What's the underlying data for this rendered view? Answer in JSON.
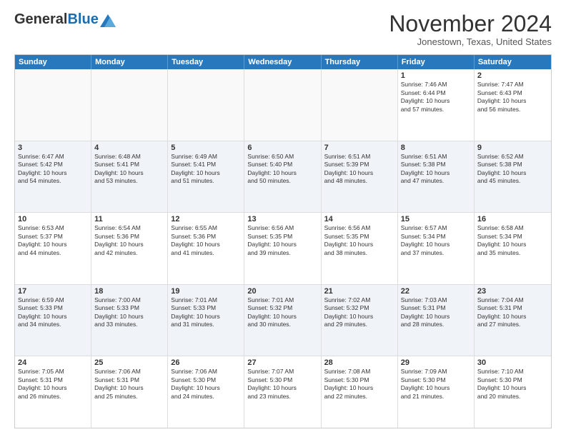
{
  "header": {
    "logo_general": "General",
    "logo_blue": "Blue",
    "month_title": "November 2024",
    "location": "Jonestown, Texas, United States"
  },
  "calendar": {
    "headers": [
      "Sunday",
      "Monday",
      "Tuesday",
      "Wednesday",
      "Thursday",
      "Friday",
      "Saturday"
    ],
    "rows": [
      [
        {
          "day": "",
          "info": ""
        },
        {
          "day": "",
          "info": ""
        },
        {
          "day": "",
          "info": ""
        },
        {
          "day": "",
          "info": ""
        },
        {
          "day": "",
          "info": ""
        },
        {
          "day": "1",
          "info": "Sunrise: 7:46 AM\nSunset: 6:44 PM\nDaylight: 10 hours\nand 57 minutes."
        },
        {
          "day": "2",
          "info": "Sunrise: 7:47 AM\nSunset: 6:43 PM\nDaylight: 10 hours\nand 56 minutes."
        }
      ],
      [
        {
          "day": "3",
          "info": "Sunrise: 6:47 AM\nSunset: 5:42 PM\nDaylight: 10 hours\nand 54 minutes."
        },
        {
          "day": "4",
          "info": "Sunrise: 6:48 AM\nSunset: 5:41 PM\nDaylight: 10 hours\nand 53 minutes."
        },
        {
          "day": "5",
          "info": "Sunrise: 6:49 AM\nSunset: 5:41 PM\nDaylight: 10 hours\nand 51 minutes."
        },
        {
          "day": "6",
          "info": "Sunrise: 6:50 AM\nSunset: 5:40 PM\nDaylight: 10 hours\nand 50 minutes."
        },
        {
          "day": "7",
          "info": "Sunrise: 6:51 AM\nSunset: 5:39 PM\nDaylight: 10 hours\nand 48 minutes."
        },
        {
          "day": "8",
          "info": "Sunrise: 6:51 AM\nSunset: 5:38 PM\nDaylight: 10 hours\nand 47 minutes."
        },
        {
          "day": "9",
          "info": "Sunrise: 6:52 AM\nSunset: 5:38 PM\nDaylight: 10 hours\nand 45 minutes."
        }
      ],
      [
        {
          "day": "10",
          "info": "Sunrise: 6:53 AM\nSunset: 5:37 PM\nDaylight: 10 hours\nand 44 minutes."
        },
        {
          "day": "11",
          "info": "Sunrise: 6:54 AM\nSunset: 5:36 PM\nDaylight: 10 hours\nand 42 minutes."
        },
        {
          "day": "12",
          "info": "Sunrise: 6:55 AM\nSunset: 5:36 PM\nDaylight: 10 hours\nand 41 minutes."
        },
        {
          "day": "13",
          "info": "Sunrise: 6:56 AM\nSunset: 5:35 PM\nDaylight: 10 hours\nand 39 minutes."
        },
        {
          "day": "14",
          "info": "Sunrise: 6:56 AM\nSunset: 5:35 PM\nDaylight: 10 hours\nand 38 minutes."
        },
        {
          "day": "15",
          "info": "Sunrise: 6:57 AM\nSunset: 5:34 PM\nDaylight: 10 hours\nand 37 minutes."
        },
        {
          "day": "16",
          "info": "Sunrise: 6:58 AM\nSunset: 5:34 PM\nDaylight: 10 hours\nand 35 minutes."
        }
      ],
      [
        {
          "day": "17",
          "info": "Sunrise: 6:59 AM\nSunset: 5:33 PM\nDaylight: 10 hours\nand 34 minutes."
        },
        {
          "day": "18",
          "info": "Sunrise: 7:00 AM\nSunset: 5:33 PM\nDaylight: 10 hours\nand 33 minutes."
        },
        {
          "day": "19",
          "info": "Sunrise: 7:01 AM\nSunset: 5:33 PM\nDaylight: 10 hours\nand 31 minutes."
        },
        {
          "day": "20",
          "info": "Sunrise: 7:01 AM\nSunset: 5:32 PM\nDaylight: 10 hours\nand 30 minutes."
        },
        {
          "day": "21",
          "info": "Sunrise: 7:02 AM\nSunset: 5:32 PM\nDaylight: 10 hours\nand 29 minutes."
        },
        {
          "day": "22",
          "info": "Sunrise: 7:03 AM\nSunset: 5:31 PM\nDaylight: 10 hours\nand 28 minutes."
        },
        {
          "day": "23",
          "info": "Sunrise: 7:04 AM\nSunset: 5:31 PM\nDaylight: 10 hours\nand 27 minutes."
        }
      ],
      [
        {
          "day": "24",
          "info": "Sunrise: 7:05 AM\nSunset: 5:31 PM\nDaylight: 10 hours\nand 26 minutes."
        },
        {
          "day": "25",
          "info": "Sunrise: 7:06 AM\nSunset: 5:31 PM\nDaylight: 10 hours\nand 25 minutes."
        },
        {
          "day": "26",
          "info": "Sunrise: 7:06 AM\nSunset: 5:30 PM\nDaylight: 10 hours\nand 24 minutes."
        },
        {
          "day": "27",
          "info": "Sunrise: 7:07 AM\nSunset: 5:30 PM\nDaylight: 10 hours\nand 23 minutes."
        },
        {
          "day": "28",
          "info": "Sunrise: 7:08 AM\nSunset: 5:30 PM\nDaylight: 10 hours\nand 22 minutes."
        },
        {
          "day": "29",
          "info": "Sunrise: 7:09 AM\nSunset: 5:30 PM\nDaylight: 10 hours\nand 21 minutes."
        },
        {
          "day": "30",
          "info": "Sunrise: 7:10 AM\nSunset: 5:30 PM\nDaylight: 10 hours\nand 20 minutes."
        }
      ]
    ]
  }
}
